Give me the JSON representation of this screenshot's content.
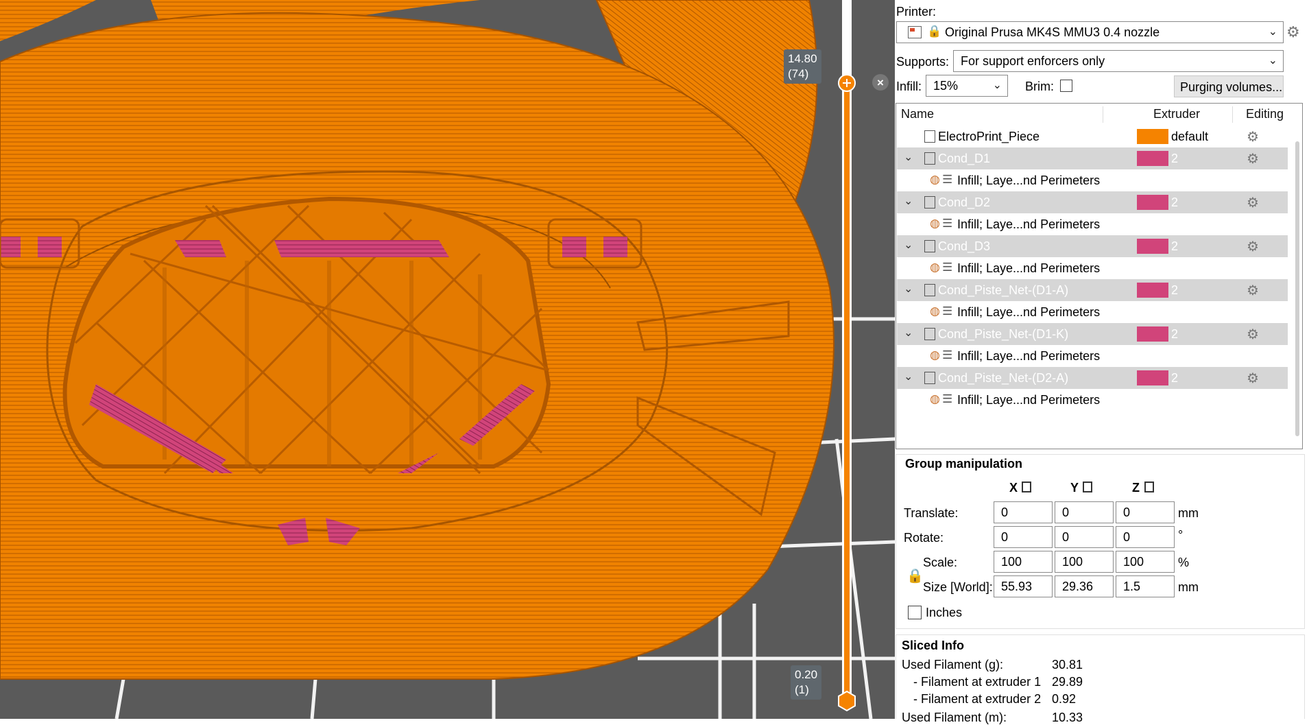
{
  "viewport": {
    "slider_top_value": "14.80",
    "slider_top_layer": "(74)",
    "slider_bottom_value": "0.20",
    "slider_bottom_layer": "(1)",
    "colors": {
      "filament1": "#F58300",
      "filament2": "#D1447A",
      "bed": "#5A5A5A"
    }
  },
  "panel": {
    "printer_label": "Printer:",
    "printer_value": "Original Prusa MK4S MMU3 0.4 nozzle",
    "supports_label": "Supports:",
    "supports_value": "For support enforcers only",
    "infill_label": "Infill:",
    "infill_value": "15%",
    "brim_label": "Brim:",
    "brim_checked": false,
    "purging_button": "Purging volumes..."
  },
  "object_list": {
    "headers": {
      "name": "Name",
      "extruder": "Extruder",
      "editing": "Editing"
    },
    "rows": [
      {
        "name": "ElectroPrint_Piece",
        "extruder": "default",
        "color": "#F58300"
      },
      {
        "name": "Cond_D1",
        "extruder": "2",
        "color": "#D1447A",
        "child": "Infill; Laye...nd Perimeters"
      },
      {
        "name": "Cond_D2",
        "extruder": "2",
        "color": "#D1447A",
        "child": "Infill; Laye...nd Perimeters"
      },
      {
        "name": "Cond_D3",
        "extruder": "2",
        "color": "#D1447A",
        "child": "Infill; Laye...nd Perimeters"
      },
      {
        "name": "Cond_Piste_Net-(D1-A)",
        "extruder": "2",
        "color": "#D1447A",
        "child": "Infill; Laye...nd Perimeters"
      },
      {
        "name": "Cond_Piste_Net-(D1-K)",
        "extruder": "2",
        "color": "#D1447A",
        "child": "Infill; Laye...nd Perimeters"
      },
      {
        "name": "Cond_Piste_Net-(D2-A)",
        "extruder": "2",
        "color": "#D1447A",
        "child": "Infill; Laye...nd Perimeters"
      }
    ]
  },
  "manipulation": {
    "title": "Group manipulation",
    "axes": [
      "X",
      "Y",
      "Z"
    ],
    "translate_label": "Translate:",
    "translate": [
      "0",
      "0",
      "0"
    ],
    "translate_unit": "mm",
    "rotate_label": "Rotate:",
    "rotate": [
      "0",
      "0",
      "0"
    ],
    "rotate_unit": "°",
    "scale_label": "Scale:",
    "scale": [
      "100",
      "100",
      "100"
    ],
    "scale_unit": "%",
    "size_label": "Size [World]:",
    "size": [
      "55.93",
      "29.36",
      "1.5"
    ],
    "size_unit": "mm",
    "inches_label": "Inches"
  },
  "sliced_info": {
    "title": "Sliced Info",
    "used_filament_g_label": "Used Filament (g):",
    "used_filament_g": "30.81",
    "extruder1_label": "- Filament at extruder 1",
    "extruder1_value": "29.89",
    "extruder2_label": "- Filament at extruder 2",
    "extruder2_value": "0.92",
    "used_filament_m_label": "Used Filament (m):",
    "used_filament_m": "10.33"
  }
}
